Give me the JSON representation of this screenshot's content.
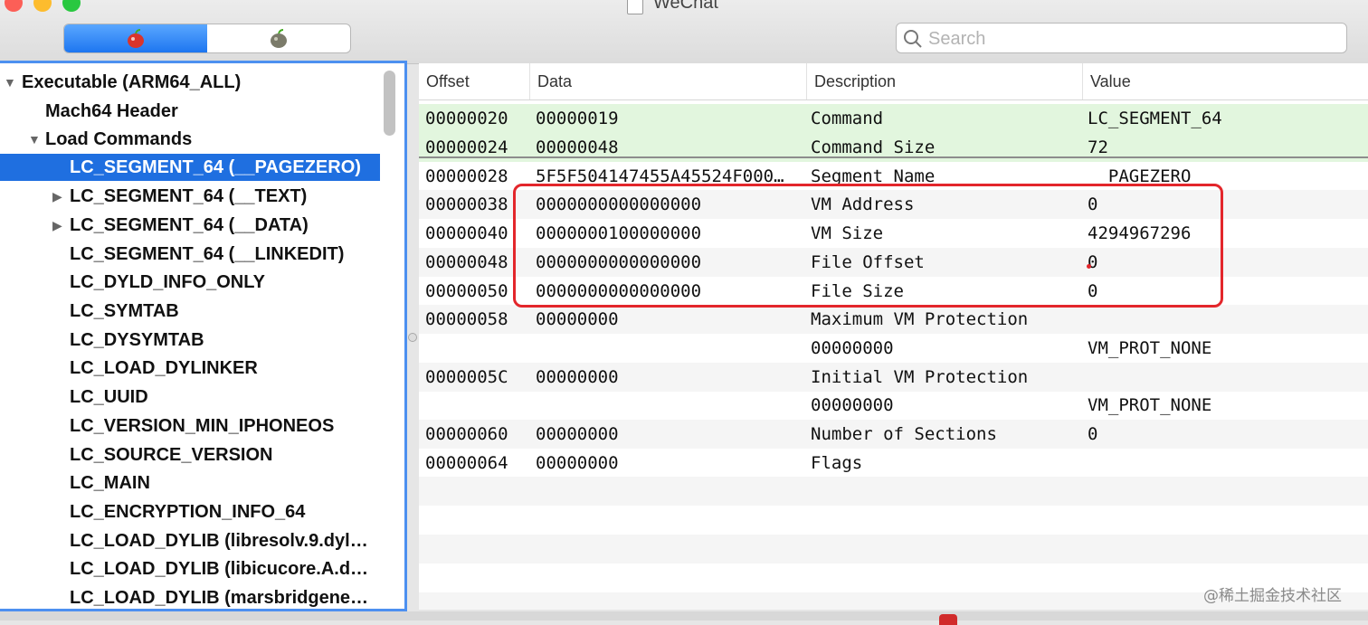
{
  "window": {
    "title": "WeChat"
  },
  "search": {
    "placeholder": "Search",
    "value": ""
  },
  "colors": {
    "accent": "#1f6fe0",
    "highlight": "#e3262b",
    "green_row": "#e2f6de"
  },
  "segmented": {
    "items": [
      {
        "icon": "red-apple-icon",
        "active": true
      },
      {
        "icon": "gray-apple-icon",
        "active": false
      }
    ]
  },
  "tree": {
    "items": [
      {
        "label": "Executable  (ARM64_ALL)",
        "expanded": true
      },
      {
        "label": "Mach64 Header"
      },
      {
        "label": "Load Commands",
        "expanded": true
      },
      {
        "label": "LC_SEGMENT_64 (__PAGEZERO)",
        "selected": true
      },
      {
        "label": "LC_SEGMENT_64 (__TEXT)",
        "collapsed": true
      },
      {
        "label": "LC_SEGMENT_64 (__DATA)",
        "collapsed": true
      },
      {
        "label": "LC_SEGMENT_64 (__LINKEDIT)"
      },
      {
        "label": "LC_DYLD_INFO_ONLY"
      },
      {
        "label": "LC_SYMTAB"
      },
      {
        "label": "LC_DYSYMTAB"
      },
      {
        "label": "LC_LOAD_DYLINKER"
      },
      {
        "label": "LC_UUID"
      },
      {
        "label": "LC_VERSION_MIN_IPHONEOS"
      },
      {
        "label": "LC_SOURCE_VERSION"
      },
      {
        "label": "LC_MAIN"
      },
      {
        "label": "LC_ENCRYPTION_INFO_64"
      },
      {
        "label": "LC_LOAD_DYLIB (libresolv.9.dyl…"
      },
      {
        "label": "LC_LOAD_DYLIB (libicucore.A.d…"
      },
      {
        "label": "LC_LOAD_DYLIB (marsbridgene…"
      }
    ]
  },
  "table": {
    "headers": [
      "Offset",
      "Data",
      "Description",
      "Value"
    ],
    "rows": [
      {
        "offset": "00000020",
        "data": "00000019",
        "desc": "Command",
        "value": "LC_SEGMENT_64"
      },
      {
        "offset": "00000024",
        "data": "00000048",
        "desc": "Command Size",
        "value": "72"
      },
      {
        "offset": "00000028",
        "data": "5F5F504147455A45524F000…",
        "desc": "Segment Name",
        "value": "__PAGEZERO"
      },
      {
        "offset": "00000038",
        "data": "0000000000000000",
        "desc": "VM Address",
        "value": "0"
      },
      {
        "offset": "00000040",
        "data": "0000000100000000",
        "desc": "VM Size",
        "value": "4294967296"
      },
      {
        "offset": "00000048",
        "data": "0000000000000000",
        "desc": "File Offset",
        "value": "0"
      },
      {
        "offset": "00000050",
        "data": "0000000000000000",
        "desc": "File Size",
        "value": "0"
      },
      {
        "offset": "00000058",
        "data": "00000000",
        "desc": "Maximum VM Protection",
        "value": ""
      },
      {
        "offset": "",
        "data": "",
        "desc": "00000000",
        "value": "VM_PROT_NONE"
      },
      {
        "offset": "0000005C",
        "data": "00000000",
        "desc": "Initial VM Protection",
        "value": ""
      },
      {
        "offset": "",
        "data": "",
        "desc": "00000000",
        "value": "VM_PROT_NONE"
      },
      {
        "offset": "00000060",
        "data": "00000000",
        "desc": "Number of Sections",
        "value": "0"
      },
      {
        "offset": "00000064",
        "data": "00000000",
        "desc": "Flags",
        "value": ""
      }
    ]
  },
  "watermark": "@稀土掘金技术社区"
}
